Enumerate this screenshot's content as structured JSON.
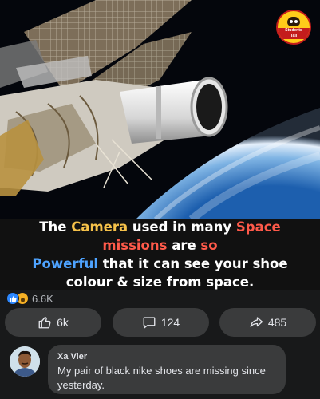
{
  "meme": {
    "brand_logo_text": "Students\nTail",
    "caption": {
      "part1": "The ",
      "camera": "Camera",
      "part2": " used in many ",
      "space_missions": "Space missions",
      "part3": " are ",
      "so": "so",
      "powerful": "Powerful",
      "part4": " that it can see your shoe colour & size from space."
    }
  },
  "reactions": {
    "icons": [
      "like-icon",
      "wow-icon"
    ],
    "count": "6.6K"
  },
  "actions": {
    "like_count": "6k",
    "comment_count": "124",
    "share_count": "485"
  },
  "comment": {
    "author": "Xa Vier",
    "text": "My pair of black nike shoes are missing since yesterday."
  },
  "colors": {
    "background": "#18191a",
    "button": "#3a3b3c",
    "highlight_yellow": "#f6c24a",
    "highlight_red": "#ff5a4a",
    "highlight_blue": "#4ea3ff",
    "like_blue": "#2d88ff"
  }
}
